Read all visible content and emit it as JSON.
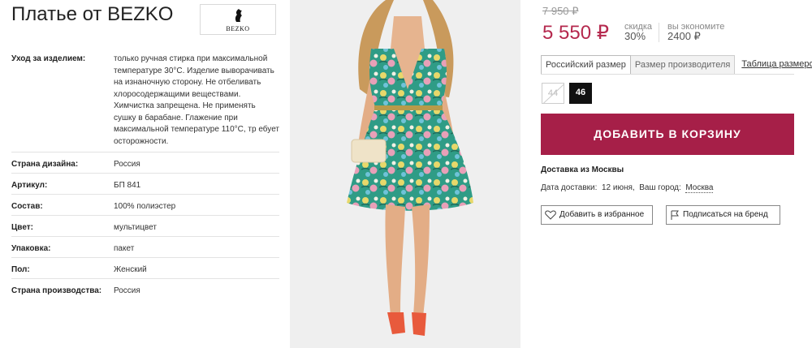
{
  "product": {
    "title": "Платье от BEZKO",
    "brand_logo_text": "BEZKO"
  },
  "attributes": [
    {
      "key": "Уход за изделием:",
      "value": "только ручная стирка при максимальной температуре 30°C. Изделие выворачивать на изнаночную сторону. Не отбеливать хлоросодержащими веществами. Химчистка запрещена. Не применять сушку в барабане. Глажение при максимальной температуре 110°C, тр ебует осторожности."
    },
    {
      "key": "Страна дизайна:",
      "value": "Россия"
    },
    {
      "key": "Артикул:",
      "value": "БП 841"
    },
    {
      "key": "Состав:",
      "value": "100% полиэстер"
    },
    {
      "key": "Цвет:",
      "value": "мультицвет"
    },
    {
      "key": "Упаковка:",
      "value": "пакет"
    },
    {
      "key": "Пол:",
      "value": "Женский"
    },
    {
      "key": "Страна производства:",
      "value": "Россия"
    }
  ],
  "price": {
    "old": "7 950 ₽",
    "current": "5 550 ₽",
    "discount_label": "скидка",
    "discount_value": "30%",
    "save_label": "вы экономите",
    "save_value": "2400 ₽"
  },
  "size_tabs": [
    "Российский размер",
    "Размер производителя",
    "Таблица размеров"
  ],
  "sizes": [
    {
      "label": "44",
      "available": false
    },
    {
      "label": "46",
      "available": true,
      "selected": true
    }
  ],
  "cart_button": "ДОБАВИТЬ В КОРЗИНУ",
  "delivery": {
    "title": "Доставка из Москвы",
    "date_label": "Дата доставки:",
    "date_value": "12 июня,",
    "city_label": "Ваш город:",
    "city_value": "Москва"
  },
  "actions": {
    "favorite": "Добавить в избранное",
    "subscribe": "Подписаться на бренд"
  },
  "colors": {
    "accent": "#a61f48",
    "price": "#b5294e"
  }
}
